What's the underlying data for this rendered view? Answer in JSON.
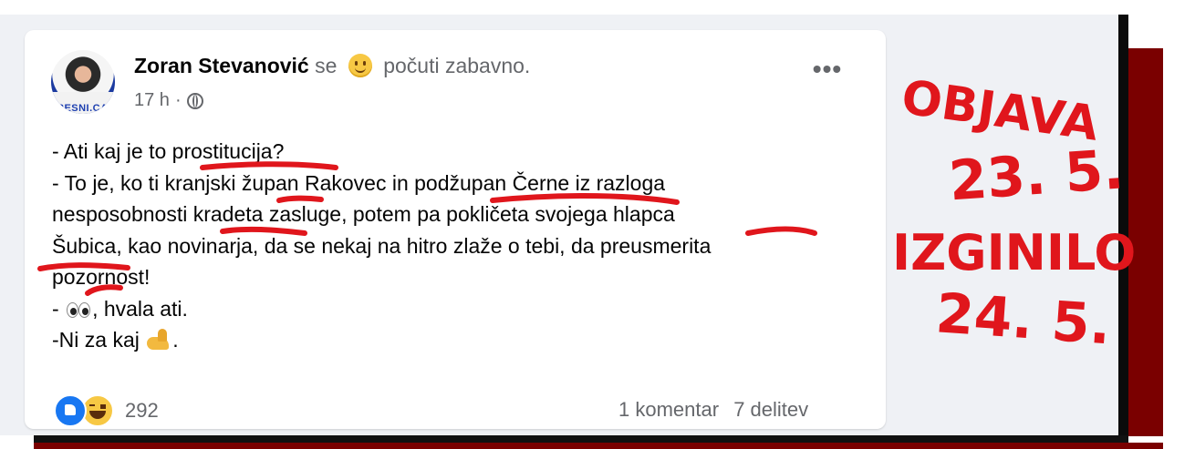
{
  "post": {
    "author": "Zoran Stevanović",
    "feeling_prefix": "se",
    "feeling_emoji": "slightly-smiling-face",
    "feeling_text": "počuti zabavno.",
    "time": "17 h",
    "separator": "·",
    "privacy_icon": "globe-icon",
    "avatar_caption": "RESNI.CA",
    "more_label": "•••",
    "lines": [
      "- Ati kaj je to prostitucija?",
      "- To je, ko ti kranjski župan Rakovec in podžupan Černe iz razloga",
      "nesposobnosti kradeta zasluge, potem pa pokličeta svojega hlapca",
      "Šubica, kao novinarja, da se nekaj na hitro zlaže o tebi, da preusmerita",
      "pozornost!"
    ],
    "line_eyes_prefix": "- ",
    "line_eyes_suffix": ", hvala ati.",
    "line_flex_prefix": "-Ni za kaj ",
    "line_flex_suffix": "."
  },
  "footer": {
    "reaction_icons": [
      "like-icon",
      "haha-icon"
    ],
    "reaction_count": "292",
    "comments": "1 komentar",
    "shares": "7 delitev"
  },
  "annotation": {
    "color": "#e0161c",
    "lines": [
      "OBJAVA",
      "23. 5.",
      "IZGINILO",
      "24. 5."
    ]
  },
  "colors": {
    "page_bg": "#eff1f5",
    "card_bg": "#ffffff",
    "text": "#050505",
    "secondary": "#65676b",
    "like_blue": "#1877f2",
    "frame_red": "#7a0000"
  }
}
